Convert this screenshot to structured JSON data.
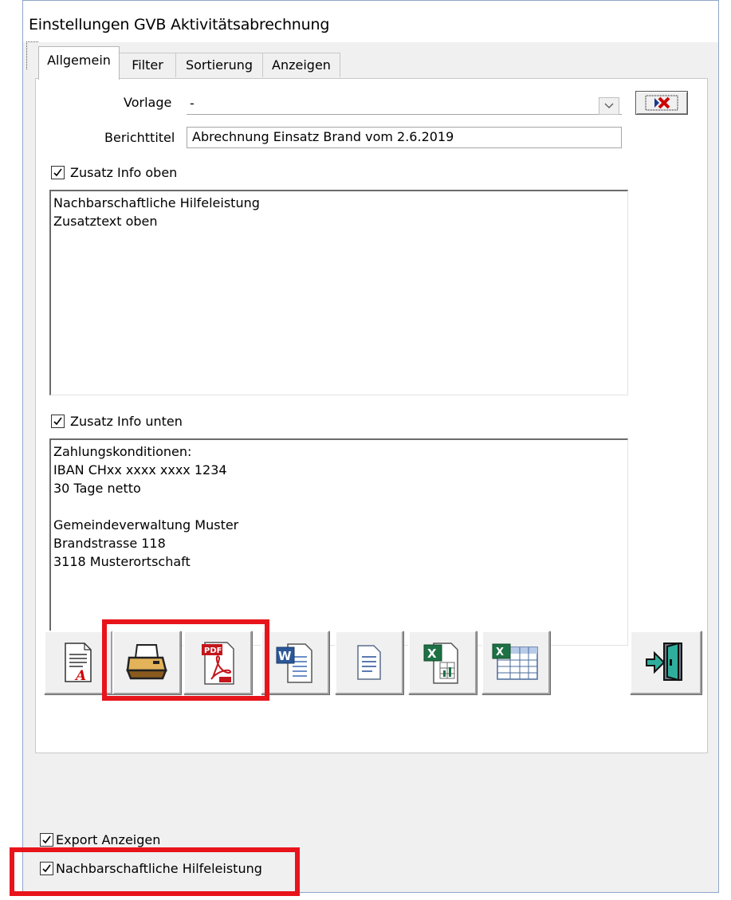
{
  "window": {
    "title": "Einstellungen GVB Aktivitätsabrechnung"
  },
  "tabs": [
    {
      "label": "Allgemein",
      "active": true
    },
    {
      "label": "Filter",
      "active": false
    },
    {
      "label": "Sortierung",
      "active": false
    },
    {
      "label": "Anzeigen",
      "active": false
    }
  ],
  "form": {
    "vorlage_label": "Vorlage",
    "vorlage_value": "-",
    "berichttitel_label": "Berichttitel",
    "berichttitel_value": "Abrechnung Einsatz Brand vom 2.6.2019"
  },
  "zusatz_oben": {
    "label": "Zusatz Info oben",
    "checked": true,
    "lines": [
      "Nachbarschaftliche Hilfeleistung",
      "Zusatztext oben"
    ]
  },
  "zusatz_unten": {
    "label": "Zusatz Info unten",
    "checked": true,
    "lines": [
      "Zahlungskonditionen:",
      "IBAN CHxx xxxx xxxx 1234",
      "30 Tage netto",
      "",
      "Gemeindeverwaltung Muster",
      "Brandstrasse 118",
      "3118 Musterortschaft"
    ]
  },
  "toolbar": {
    "buttons": [
      {
        "icon": "report-preview-icon"
      },
      {
        "icon": "printer-icon"
      },
      {
        "icon": "pdf-icon",
        "badge": "PDF"
      },
      {
        "icon": "word-icon"
      },
      {
        "icon": "text-document-icon"
      },
      {
        "icon": "excel-icon"
      },
      {
        "icon": "spreadsheet-icon"
      },
      {
        "icon": "exit-door-icon"
      }
    ]
  },
  "options": {
    "export_anzeigen": {
      "label": "Export Anzeigen",
      "checked": true
    },
    "nachbarschaftliche": {
      "label": "Nachbarschaftliche Hilfeleistung",
      "checked": true
    }
  },
  "colors": {
    "highlight": "#e8141b",
    "word_blue": "#2b5797",
    "excel_green": "#1e7145",
    "pdf_red": "#c4161c"
  }
}
